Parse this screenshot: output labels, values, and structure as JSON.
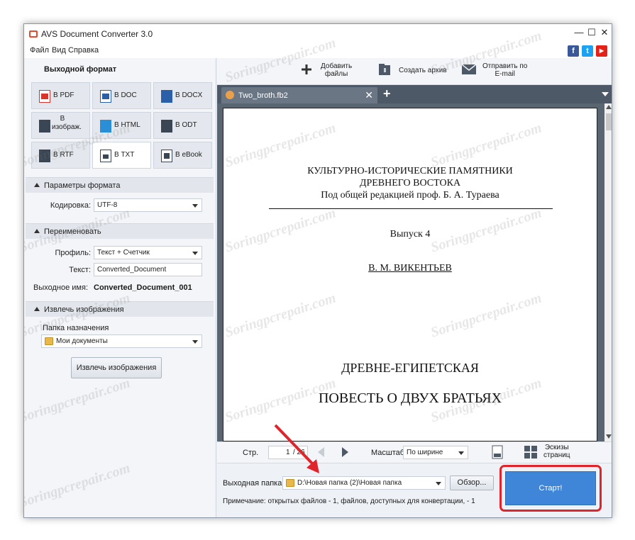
{
  "window": {
    "title": "AVS Document Converter 3.0",
    "minimize": "—",
    "maximize": "☐",
    "close": "✕"
  },
  "menu": [
    "Файл",
    "Вид",
    "Справка"
  ],
  "social": {
    "facebook": "f",
    "twitter": "t",
    "youtube": "▶",
    "facebook_color": "#3b5998",
    "twitter_color": "#1da1f2",
    "youtube_color": "#e62117"
  },
  "left": {
    "output_format_title": "Выходной формат",
    "formats": [
      {
        "label": "В PDF",
        "icon": "pdf-icon",
        "color": "#d9342b"
      },
      {
        "label": "В DOC",
        "icon": "doc-icon",
        "color": "#2b5fa8"
      },
      {
        "label": "В DOCX",
        "icon": "docx-icon",
        "color": "#2b5fa8"
      },
      {
        "label": "В изображ.",
        "icon": "image-icon",
        "color": "#3a4654"
      },
      {
        "label": "В HTML",
        "icon": "html-icon",
        "color": "#2a8fd6"
      },
      {
        "label": "В ODT",
        "icon": "odt-icon",
        "color": "#3a4654"
      },
      {
        "label": "В RTF",
        "icon": "rtf-icon",
        "color": "#3a4654"
      },
      {
        "label": "В TXT",
        "icon": "txt-icon",
        "color": "#3a4654"
      },
      {
        "label": "В eBook",
        "icon": "ebook-icon",
        "color": "#3a4654"
      }
    ],
    "format_params": {
      "title": "Параметры формата",
      "encoding_label": "Кодировка:",
      "encoding_value": "UTF-8"
    },
    "rename": {
      "title": "Переименовать",
      "profile_label": "Профиль:",
      "profile_value": "Текст + Счетчик",
      "text_label": "Текст:",
      "text_value": "Converted_Document",
      "output_name_label": "Выходное имя:",
      "output_name_value": "Converted_Document_001"
    },
    "extract": {
      "title": "Извлечь изображения",
      "dest_label": "Папка назначения",
      "dest_value": "Мои документы",
      "button": "Извлечь изображения"
    }
  },
  "toolbar": {
    "add_files": "Добавить\nфайлы",
    "create_archive": "Создать архив",
    "send_email": "Отправить по\nE-mail"
  },
  "tab": {
    "name": "Two_broth.fb2",
    "add": "+"
  },
  "document": {
    "line1": "КУЛЬТУРНО-ИСТОРИЧЕСКИЕ ПАМЯТНИКИ",
    "line2": "ДРЕВНЕГО ВОСТОКА",
    "line3": "Под общей редакцией проф. Б. А. Тураева",
    "issue": "Выпуск 4",
    "author": "В. М. ВИКЕНТЬЕВ",
    "heading1": "ДРЕВНЕ-ЕГИПЕТСКАЯ",
    "heading2": "ПОВЕСТЬ О ДВУХ БРАТЬЯХ"
  },
  "nav": {
    "page_label": "Стр.",
    "page_value": "1",
    "page_total": "/ 26",
    "zoom_label": "Масштаб",
    "zoom_value": "По ширине",
    "thumbs_label": "Эскизы\nстраниц"
  },
  "output": {
    "folder_label": "Выходная папка:",
    "folder_value": "D:\\Новая папка (2)\\Новая папка",
    "browse": "Обзор...",
    "note": "Примечание: открытых файлов - 1, файлов, доступных для конвертации, - 1",
    "start": "Старт!"
  },
  "watermark": "Soringpcrepair.com",
  "colors": {
    "accent": "#3f86d8",
    "highlight": "#e0242c",
    "dark": "#4d5966"
  }
}
